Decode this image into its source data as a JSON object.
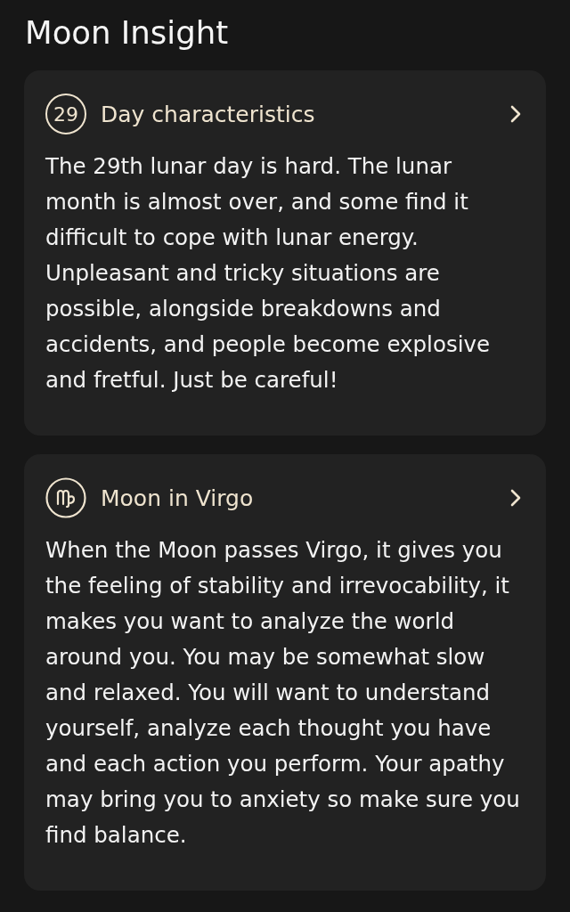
{
  "title": "Moon Insight",
  "cards": [
    {
      "kind": "day",
      "badge": "29",
      "title": "Day characteristics",
      "text": "The 29th lunar day is hard. The lunar month is almost over, and some find it difficult to cope with lunar energy. Unpleasant and tricky situations are possible, alongside breakdowns and accidents, and people become explosive and fretful. Just be careful!"
    },
    {
      "kind": "sign",
      "title": "Moon in Virgo",
      "text": "When the Moon passes Virgo, it gives you the feeling of stability and irrevocability, it makes you want to analyze the world around you. You may be somewhat slow and relaxed. You will want to understand yourself, analyze each thought you have and each action you perform. Your apathy may bring you to anxiety so make sure you find balance."
    }
  ]
}
